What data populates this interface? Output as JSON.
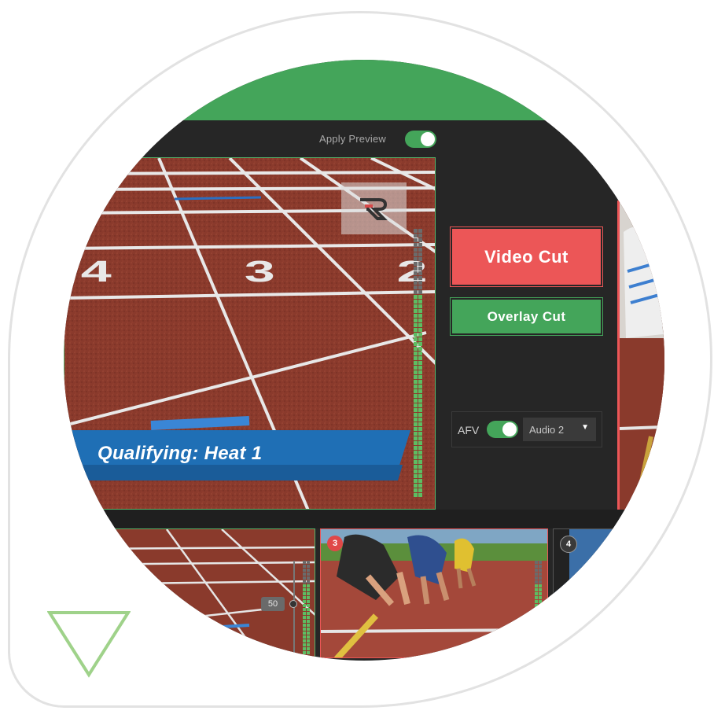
{
  "preview_header": {
    "apply_preview_label": "Apply Preview",
    "apply_preview_on": true
  },
  "preview": {
    "lower_third_title": "Qualifying: Heat 1",
    "lane_numbers": [
      "4",
      "3",
      "2"
    ]
  },
  "controls": {
    "video_cut_label": "Video Cut",
    "overlay_cut_label": "Overlay Cut",
    "afv_label": "AFV",
    "afv_on": true,
    "audio_source": "Audio 2",
    "caret": "▼"
  },
  "sources": [
    {
      "number": "",
      "volume": "50"
    },
    {
      "number": "3"
    },
    {
      "number": "4"
    }
  ],
  "colors": {
    "accent_green": "#44a55a",
    "cut_red": "#ec5657",
    "panel_dark": "#262626",
    "lower_third_blue": "#1f6fb5"
  },
  "icons": [
    "logo-icon",
    "down-triangle-icon",
    "caret-down-icon"
  ]
}
